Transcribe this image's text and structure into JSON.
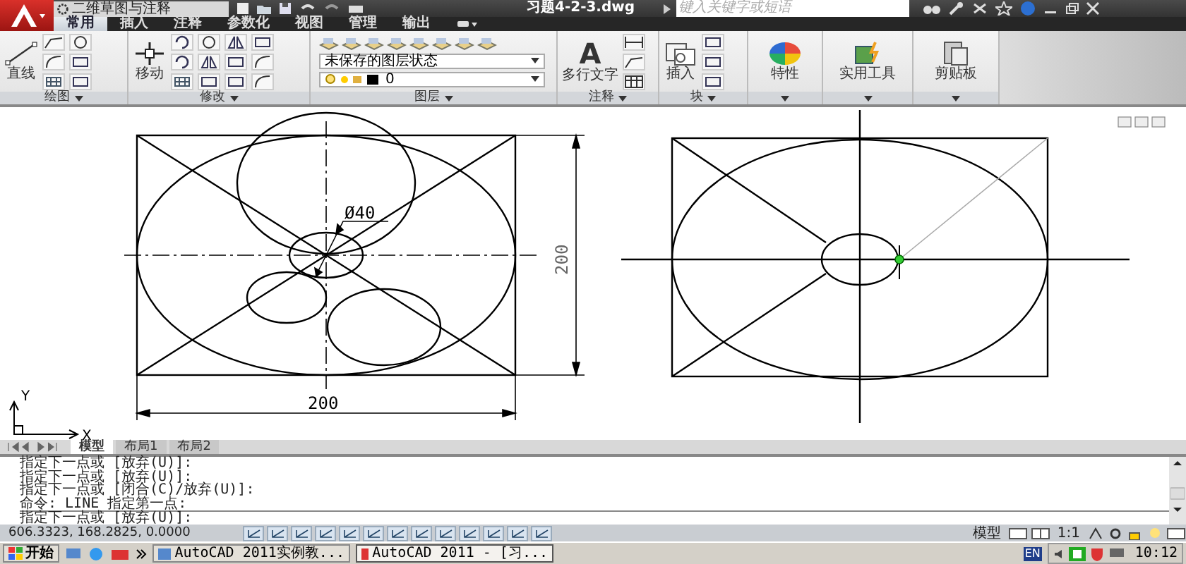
{
  "title_bar": {
    "workspace": "二维草图与注释",
    "title": "习题4-2-3.dwg",
    "search": {
      "placeholder": "键入关键字或短语"
    }
  },
  "ribbon_tabs": [
    {
      "label": "常用",
      "selected": true
    },
    {
      "label": "插入",
      "selected": false
    },
    {
      "label": "注释",
      "selected": false
    },
    {
      "label": "参数化",
      "selected": false
    },
    {
      "label": "视图",
      "selected": false
    },
    {
      "label": "管理",
      "selected": false
    },
    {
      "label": "输出",
      "selected": false
    }
  ],
  "panels": [
    {
      "kind": "draw",
      "title": "绘图",
      "big_button": "直线"
    },
    {
      "kind": "modify",
      "title": "修改",
      "big_button": "移动"
    },
    {
      "kind": "layers",
      "title": "图层",
      "layer_state": "未保存的图层状态",
      "current_layer": "0"
    },
    {
      "kind": "annotate",
      "title": "注释",
      "big_button": "多行文字",
      "icon_glyph": "A"
    },
    {
      "kind": "block",
      "title": "块",
      "big_button": "插入"
    },
    {
      "kind": "properties",
      "big_button": "特性"
    },
    {
      "kind": "utilities",
      "big_button": "实用工具"
    },
    {
      "kind": "clipboard",
      "big_button": "剪贴板"
    }
  ],
  "drawing": {
    "diameter_label": "Ø40",
    "height_label": "200",
    "width_label": "200",
    "ucs": {
      "x": "X",
      "y": "Y"
    }
  },
  "layout_tabs": [
    {
      "label": "模型",
      "selected": true
    },
    {
      "label": "布局1",
      "selected": false
    },
    {
      "label": "布局2",
      "selected": false
    }
  ],
  "command_history": [
    "指定下一点或 [放弃(U)]:",
    "指定下一点或 [放弃(U)]:",
    "指定下一点或 [闭合(C)/放弃(U)]:",
    "命令:  LINE 指定第一点:"
  ],
  "command_line": "指定下一点或 [放弃(U)]:",
  "status_bar": {
    "coordinates": "606.3323, 168.2825, 0.0000",
    "space": "模型",
    "scale": "1:1"
  },
  "taskbar": {
    "start": "开始",
    "windows": [
      {
        "label": "AutoCAD 2011实例教...",
        "selected": false
      },
      {
        "label": "AutoCAD 2011 - [习...",
        "selected": true
      }
    ],
    "language": "EN",
    "clock": "10:12"
  }
}
